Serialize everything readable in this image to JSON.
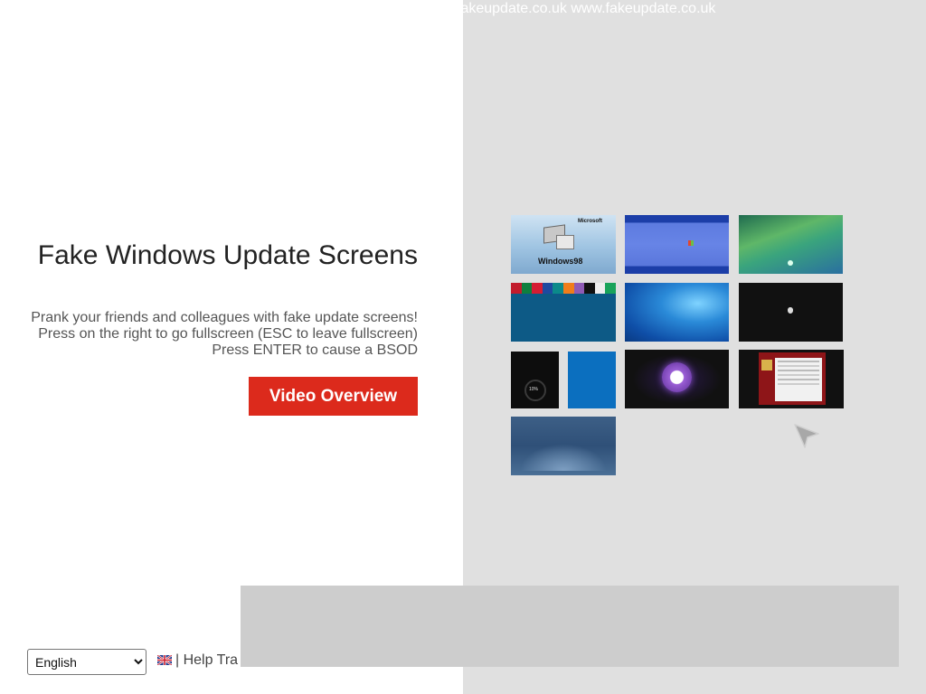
{
  "header": {
    "domain_text": "fakeupdate.co.uk www.fakeupdate.co.uk"
  },
  "main": {
    "title": "Fake Windows Update Screens",
    "description_lines": [
      "Prank your friends and colleagues with fake update screens!",
      "Press on the right to go fullscreen (ESC to leave fullscreen)",
      "Press ENTER to cause a BSOD"
    ],
    "video_button_label": "Video Overview"
  },
  "thumbnails": [
    {
      "name": "windows-98",
      "label": "Windows98",
      "sublabel": "Microsoft"
    },
    {
      "name": "windows-xp"
    },
    {
      "name": "windows-vista"
    },
    {
      "name": "windows-8"
    },
    {
      "name": "windows-7"
    },
    {
      "name": "mac-os"
    },
    {
      "name": "windows-10-installing",
      "label": "10%"
    },
    {
      "name": "windows-10-update"
    },
    {
      "name": "steam"
    },
    {
      "name": "ransomware"
    },
    {
      "name": "windows-10-blue-update"
    }
  ],
  "footer": {
    "language_selected": "English",
    "language_options": [
      "English"
    ],
    "links_text": "| Help Tra"
  },
  "colors": {
    "accent": "#dc2a1c",
    "right_panel_bg": "#e0e0e0"
  }
}
